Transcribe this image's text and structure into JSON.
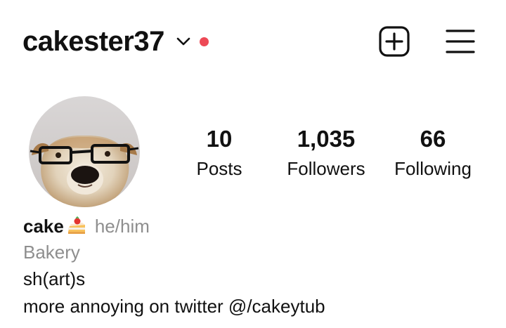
{
  "header": {
    "username": "cakester37",
    "chevron_icon": "chevron-down-icon",
    "notification_color": "#ed4956",
    "new_post_icon": "plus-square-icon",
    "menu_icon": "hamburger-menu-icon"
  },
  "profile": {
    "avatar": "dog-with-glasses-avatar",
    "stats": {
      "posts": {
        "value": "10",
        "label": "Posts"
      },
      "followers": {
        "value": "1,035",
        "label": "Followers"
      },
      "following": {
        "value": "66",
        "label": "Following"
      }
    },
    "bio": {
      "display_name": "cake",
      "emoji_icon": "shortcake-emoji-icon",
      "pronouns": "he/him",
      "category": "Bakery",
      "lines": [
        "sh(art)s",
        "more annoying on twitter @/cakeytub"
      ]
    }
  },
  "colors": {
    "text": "#111111",
    "secondary": "#8e8e8e",
    "accent_dot": "#ed4956"
  }
}
